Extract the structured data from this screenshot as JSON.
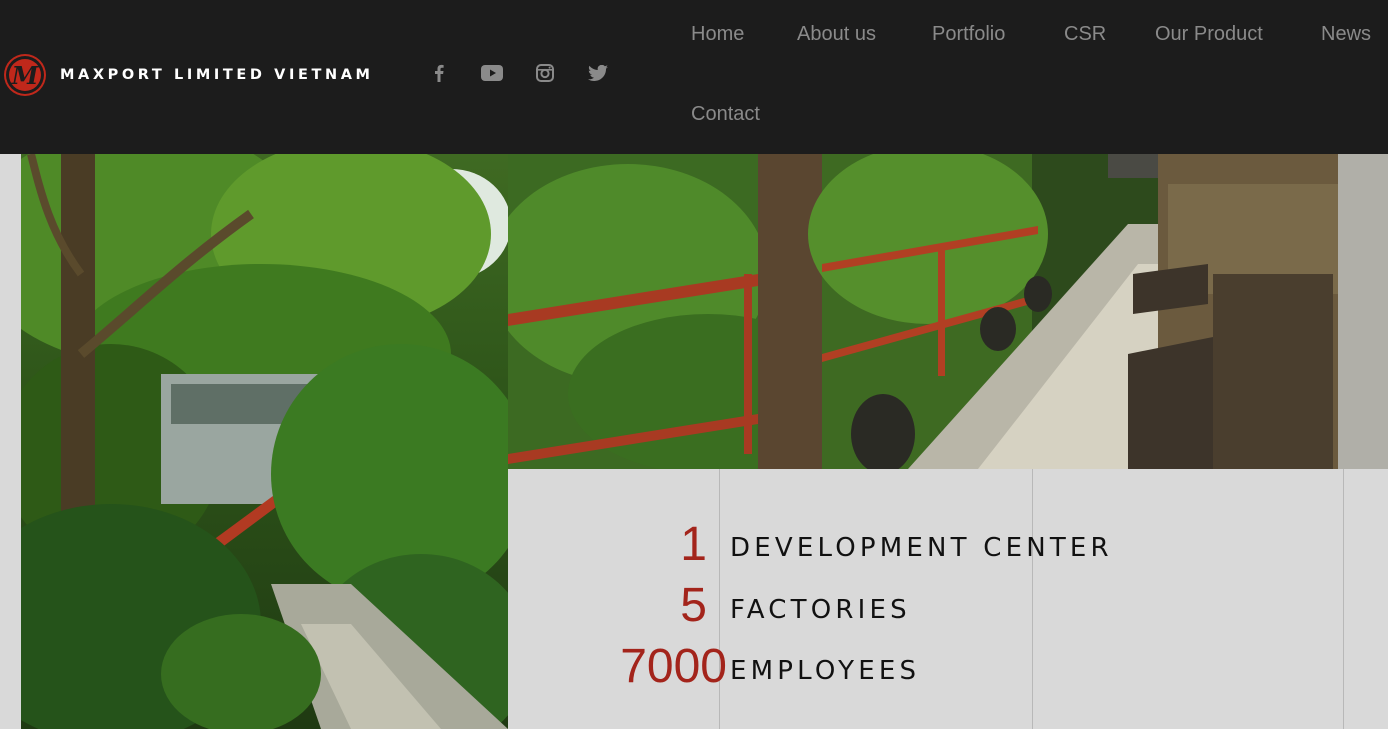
{
  "header": {
    "brand": "MAXPORT LIMITED VIETNAM",
    "logo_letter": "M"
  },
  "socials": [
    {
      "name": "facebook-icon"
    },
    {
      "name": "youtube-icon"
    },
    {
      "name": "instagram-icon"
    },
    {
      "name": "twitter-icon"
    }
  ],
  "nav": {
    "home": "Home",
    "about": "About us",
    "portfolio": "Portfolio",
    "csr": "CSR",
    "product": "Our Product",
    "news": "News",
    "contact": "Contact"
  },
  "stats": [
    {
      "number": "1",
      "label": "DEVELOPMENT CENTER"
    },
    {
      "number": "5",
      "label": "FACTORIES"
    },
    {
      "number": "7000",
      "label": "EMPLOYEES"
    }
  ],
  "colors": {
    "header_bg": "#1c1c1c",
    "accent": "#a3241b",
    "nav_text": "#8a8a8a",
    "panel_bg": "#d9d9d9"
  }
}
